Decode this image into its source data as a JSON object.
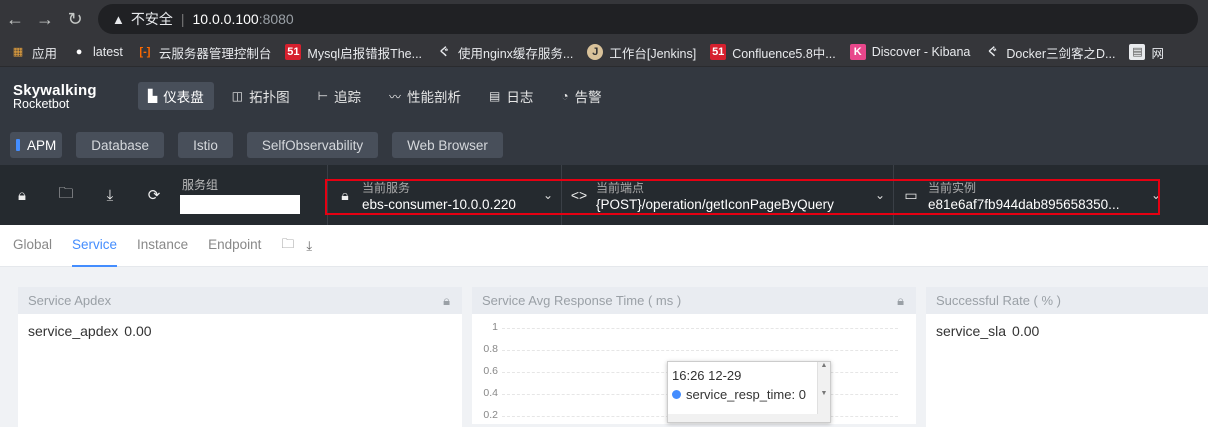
{
  "browser": {
    "back": "←",
    "forward": "→",
    "reload": "↻",
    "insecure_label": "不安全",
    "url_host": "10.0.0.100",
    "url_port": ":8080"
  },
  "bookmarks": [
    {
      "label": "应用",
      "icon": "apps-grid-icon",
      "color": "#e8a33d"
    },
    {
      "label": "latest",
      "icon": "github-icon",
      "color": "#ffffff"
    },
    {
      "label": "云服务器管理控制台",
      "icon": "aliyun-icon",
      "color": "#ff6a00"
    },
    {
      "label": "Mysql启报错报The...",
      "icon": "51cto-icon",
      "color": "#d6202e"
    },
    {
      "label": "使用nginx缓存服务...",
      "icon": "feather-icon",
      "color": "#e8eaed"
    },
    {
      "label": "工作台[Jenkins]",
      "icon": "jenkins-icon",
      "color": "#d9c29a"
    },
    {
      "label": "Confluence5.8中...",
      "icon": "51cto-icon",
      "color": "#d6202e"
    },
    {
      "label": "Discover - Kibana",
      "icon": "kibana-icon",
      "color": "#e8478b"
    },
    {
      "label": "Docker三剑客之D...",
      "icon": "feather-icon",
      "color": "#e8eaed"
    },
    {
      "label": "网",
      "icon": "page-icon",
      "color": "#e8eaed"
    }
  ],
  "app": {
    "logo_line1": "Skywalking",
    "logo_line2": "Rocketbot",
    "nav": [
      {
        "label": "仪表盘",
        "icon": "dashboard-icon",
        "active": true
      },
      {
        "label": "拓扑图",
        "icon": "topology-icon",
        "active": false
      },
      {
        "label": "追踪",
        "icon": "trace-icon",
        "active": false
      },
      {
        "label": "性能剖析",
        "icon": "profile-icon",
        "active": false
      },
      {
        "label": "日志",
        "icon": "log-icon",
        "active": false
      },
      {
        "label": "告警",
        "icon": "alarm-icon",
        "active": false
      }
    ],
    "layers": [
      "APM",
      "Database",
      "Istio",
      "SelfObservability",
      "Web Browser"
    ]
  },
  "toolbar": {
    "service_group_label": "服务组",
    "service_group_value": "",
    "current_service_label": "当前服务",
    "current_service_value": "ebs-consumer-10.0.0.220",
    "current_endpoint_label": "当前端点",
    "current_endpoint_value": "{POST}/operation/getIconPageByQuery",
    "current_instance_label": "当前实例",
    "current_instance_value": "e81e6af7fb944dab895658350..."
  },
  "tabs": [
    "Global",
    "Service",
    "Instance",
    "Endpoint"
  ],
  "active_tab": "Service",
  "cards": {
    "apdex": {
      "title": "Service Apdex",
      "key": "service_apdex",
      "value": "0.00"
    },
    "resp_time": {
      "title": "Service Avg Response Time ( ms )"
    },
    "sla": {
      "title": "Successful Rate ( % )",
      "key": "service_sla",
      "value": "0.00"
    }
  },
  "chart_data": {
    "type": "line",
    "title": "Service Avg Response Time ( ms )",
    "xlabel": "",
    "ylabel": "",
    "y_ticks": [
      "1",
      "0.8",
      "0.6",
      "0.4",
      "0.2"
    ],
    "ylim": [
      0,
      1
    ],
    "series": [
      {
        "name": "service_resp_time",
        "x": [
          "12-29 16:26"
        ],
        "values": [
          0
        ]
      }
    ],
    "tooltip": {
      "time": "16:26 12-29",
      "series": "service_resp_time",
      "value": "0"
    },
    "grid": true
  },
  "colors": {
    "accent": "#448dfe",
    "highlight_box": "#e60012",
    "header": "#333840"
  }
}
